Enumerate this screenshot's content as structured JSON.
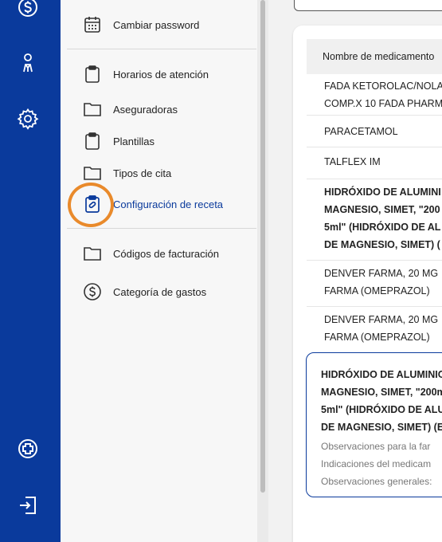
{
  "rail": {
    "icons": [
      "dollar-circle-icon",
      "medical-staff-icon",
      "gear-icon",
      "plus-circle-icon",
      "logout-icon"
    ]
  },
  "menu": {
    "items": [
      {
        "label": "Cambiar password",
        "icon": "calendar-icon"
      },
      {
        "label": "Horarios de atención",
        "icon": "clipboard-icon"
      },
      {
        "label": "Aseguradoras",
        "icon": "folder-icon"
      },
      {
        "label": "Plantillas",
        "icon": "clipboard-icon"
      },
      {
        "label": "Tipos de cita",
        "icon": "folder-icon"
      },
      {
        "label": "Configuración de receta",
        "icon": "prescription-clipboard-icon",
        "active": true
      },
      {
        "label": "Códigos de facturación",
        "icon": "folder-icon"
      },
      {
        "label": "Categoría de gastos",
        "icon": "dollar-circle-icon"
      }
    ]
  },
  "table": {
    "header": "Nombre de medicamento",
    "rows": [
      {
        "lines": [
          "FADA KETOROLAC/NOLA",
          "COMP.X 10 FADA PHARM"
        ]
      },
      {
        "lines": [
          "PARACETAMOL"
        ]
      },
      {
        "lines": [
          "TALFLEX IM"
        ]
      },
      {
        "lines": [
          "HIDRÓXIDO DE ALUMINI",
          "MAGNESIO, SIMET, \"200",
          "5ml\" (HIDRÓXIDO DE AL",
          "DE MAGNESIO, SIMET) ("
        ]
      },
      {
        "lines": [
          "DENVER FARMA, 20 MG",
          "FARMA (OMEPRAZOL)"
        ]
      },
      {
        "lines": [
          "DENVER FARMA, 20 MG",
          "FARMA (OMEPRAZOL)"
        ]
      }
    ]
  },
  "selected": {
    "title_lines": [
      "HIDRÓXIDO DE ALUMINIO",
      "MAGNESIO, SIMET, \"200m",
      "5ml\" (HIDRÓXIDO DE ALU",
      "DE MAGNESIO, SIMET) (E"
    ],
    "meta_lines": [
      "Observaciones para la far",
      "Indicaciones del medicam",
      "Observaciones generales:"
    ]
  },
  "colors": {
    "primary": "#0a3a9c",
    "highlight": "#e98a2b"
  }
}
